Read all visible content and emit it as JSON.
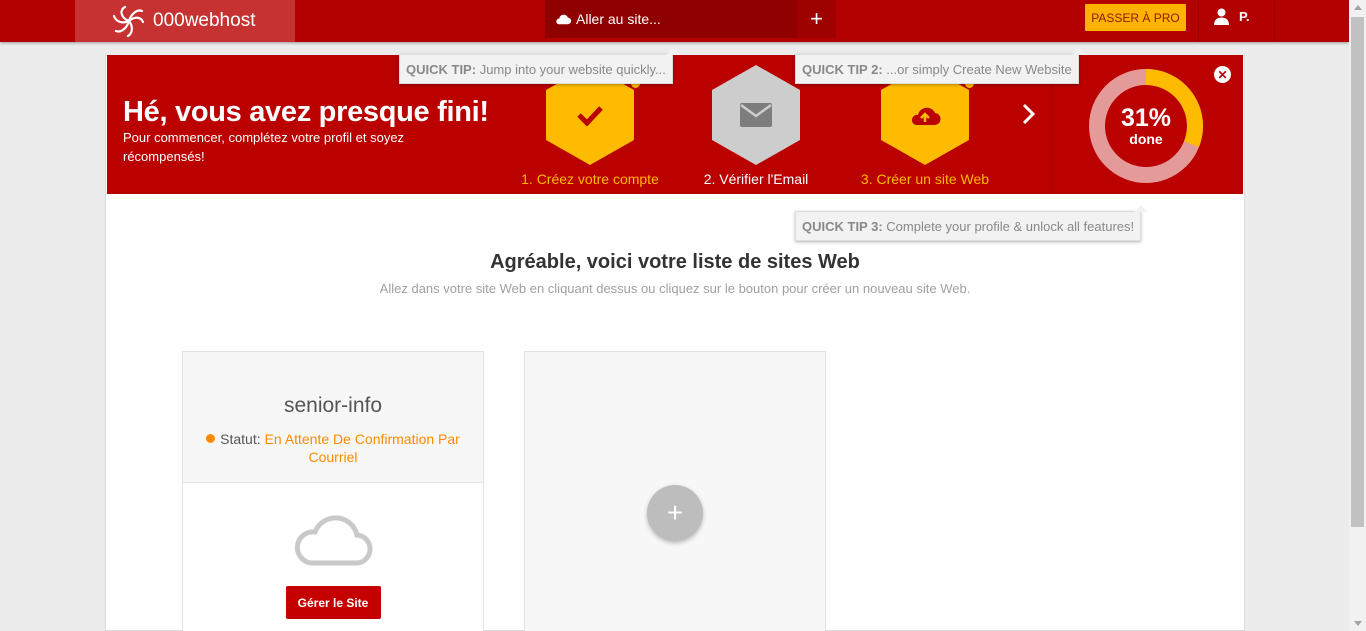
{
  "topbar": {
    "logo_text": "000webhost",
    "goto_label": "Aller au site...",
    "add_symbol": "+",
    "pro_button": "PASSER À PRO",
    "user_initial": "P."
  },
  "banner": {
    "title": "Hé, vous avez presque fini!",
    "subtitle": "Pour commencer, complétez votre profil et soyez récompensés!",
    "steps": [
      {
        "label": "1. Créez votre compte",
        "icon": "check-icon",
        "state": "done"
      },
      {
        "label": "2. Vérifier l'Email",
        "icon": "envelope-icon",
        "state": "pending"
      },
      {
        "label": "3. Créer un site Web",
        "icon": "cloud-upload-icon",
        "state": "done"
      }
    ],
    "progress_percent": 31,
    "progress_text": "31%",
    "progress_caption": "done",
    "close_symbol": "✕"
  },
  "tips": {
    "tip1_label": "QUICK TIP:",
    "tip1_text": "Jump into your website quickly...",
    "tip2_label": "QUICK TIP 2:",
    "tip2_text": "...or simply Create New Website",
    "tip3_label": "QUICK TIP 3:",
    "tip3_text": "Complete your profile & unlock all features!"
  },
  "main": {
    "title": "Agréable, voici votre liste de sites Web",
    "subtitle": "Allez dans votre site Web en cliquant dessus ou cliquez sur le bouton pour créer un nouveau site Web."
  },
  "site_card": {
    "name": "senior-info",
    "status_label": "Statut:",
    "status_value": "En Attente De Confirmation Par Courriel",
    "manage_button": "Gérer le Site"
  },
  "new_card": {
    "add_symbol": "+"
  },
  "colors": {
    "brand_red": "#bb0000",
    "accent_yellow": "#ffbb00",
    "status_orange": "#ff8a00"
  }
}
